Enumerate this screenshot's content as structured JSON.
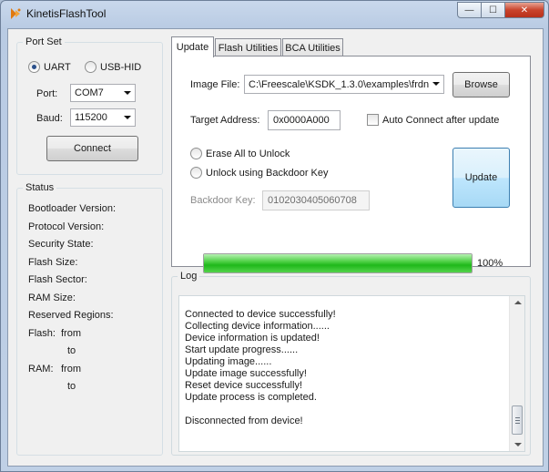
{
  "window": {
    "title": "KinetisFlashTool",
    "controls": {
      "minimize": "—",
      "maximize": "☐",
      "close": "✕"
    }
  },
  "port_set": {
    "title": "Port Set",
    "uart_label": "UART",
    "usbhid_label": "USB-HID",
    "selected": "UART",
    "port_label": "Port:",
    "port_value": "COM7",
    "baud_label": "Baud:",
    "baud_value": "115200",
    "connect_label": "Connect"
  },
  "status": {
    "title": "Status",
    "bootloader_version": "Bootloader Version:",
    "protocol_version": "Protocol Version:",
    "security_state": "Security State:",
    "flash_size": "Flash Size:",
    "flash_sector": "Flash Sector:",
    "ram_size": "RAM Size:",
    "reserved_regions": "Reserved Regions:",
    "flash_label": "Flash:",
    "flash_from": "from",
    "flash_to": "to",
    "ram_label": "RAM:",
    "ram_from": "from",
    "ram_to": "to"
  },
  "tabs": [
    {
      "label": "Update",
      "active": true
    },
    {
      "label": "Flash Utilities",
      "active": false
    },
    {
      "label": "BCA Utilities",
      "active": false
    }
  ],
  "update": {
    "image_file_label": "Image File:",
    "image_file_value": "C:\\Freescale\\KSDK_1.3.0\\examples\\frdn",
    "browse_label": "Browse",
    "target_address_label": "Target Address:",
    "target_address_value": "0x0000A000",
    "auto_connect_label": "Auto Connect after update",
    "erase_all_label": "Erase All to Unlock",
    "backdoor_label": "Unlock using Backdoor Key",
    "backdoor_key_label": "Backdoor Key:",
    "backdoor_key_value": "0102030405060708",
    "update_button_label": "Update",
    "progress_percent": 100,
    "progress_text": "100%"
  },
  "log": {
    "title": "Log",
    "lines": [
      "Connected to device successfully!",
      "Collecting device information......",
      "Device information is updated!",
      "Start update progress......",
      "Updating image......",
      "Update image successfully!",
      "Reset device successfully!",
      "Update process is completed.",
      "",
      "Disconnected from device!"
    ]
  },
  "colors": {
    "progress_fill": "#1fb81a",
    "window_frame": "#b9cbe3",
    "close_button": "#c9432c"
  },
  "icons": {
    "app": "kinetis-flash-tool-icon"
  }
}
